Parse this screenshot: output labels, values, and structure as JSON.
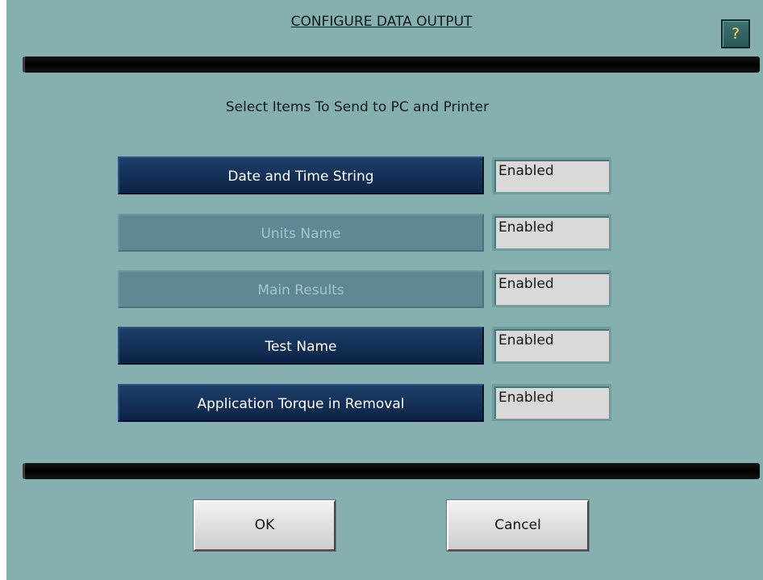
{
  "title": "CONFIGURE DATA OUTPUT",
  "help_label": "?",
  "subtitle": "Select Items To Send to PC and Printer",
  "items": [
    {
      "label": "Date and Time String",
      "status": "Enabled",
      "state": "active"
    },
    {
      "label": "Units Name",
      "status": "Enabled",
      "state": "disabled"
    },
    {
      "label": "Main Results",
      "status": "Enabled",
      "state": "disabled"
    },
    {
      "label": "Test Name",
      "status": "Enabled",
      "state": "active"
    },
    {
      "label": "Application Torque in Removal",
      "status": "Enabled",
      "state": "active"
    }
  ],
  "buttons": {
    "ok": "OK",
    "cancel": "Cancel"
  },
  "colors": {
    "background": "#86b0b0",
    "active_button": "#163560",
    "disabled_button": "#5e8893",
    "help_glyph": "#f2e24a"
  }
}
